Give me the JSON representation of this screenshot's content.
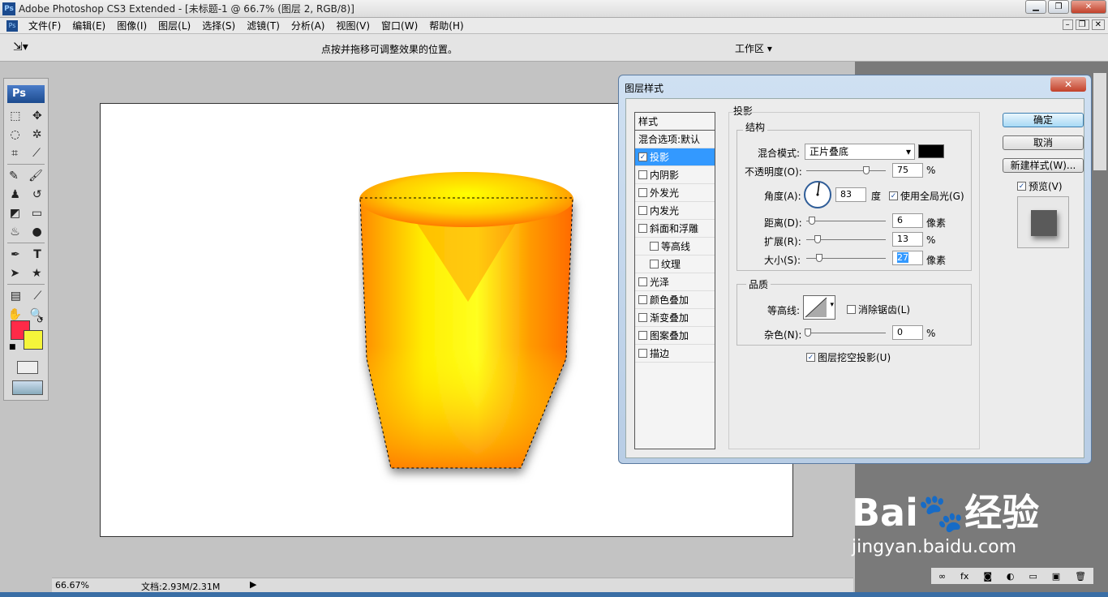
{
  "app": {
    "title": "Adobe Photoshop CS3 Extended - [未标题-1 @ 66.7% (图层 2, RGB/8)]",
    "ps_logo": "Ps"
  },
  "menu": [
    "文件(F)",
    "编辑(E)",
    "图像(I)",
    "图层(L)",
    "选择(S)",
    "滤镜(T)",
    "分析(A)",
    "视图(V)",
    "窗口(W)",
    "帮助(H)"
  ],
  "options_bar": {
    "hint": "点按并拖移可调整效果的位置。",
    "workspace": "工作区"
  },
  "status_bar": {
    "zoom": "66.67%",
    "doc_info": "文档:2.93M/2.31M"
  },
  "colors": {
    "foreground": "#ff2a48",
    "background": "#f5f53a"
  },
  "dialog": {
    "title": "图层样式",
    "styles_header": "样式",
    "blend_defaults": "混合选项:默认",
    "styles": [
      {
        "label": "投影",
        "checked": true,
        "selected": true
      },
      {
        "label": "内阴影",
        "checked": false
      },
      {
        "label": "外发光",
        "checked": false
      },
      {
        "label": "内发光",
        "checked": false
      },
      {
        "label": "斜面和浮雕",
        "checked": false
      },
      {
        "label": "等高线",
        "checked": false,
        "sub": true
      },
      {
        "label": "纹理",
        "checked": false,
        "sub": true
      },
      {
        "label": "光泽",
        "checked": false
      },
      {
        "label": "颜色叠加",
        "checked": false
      },
      {
        "label": "渐变叠加",
        "checked": false
      },
      {
        "label": "图案叠加",
        "checked": false
      },
      {
        "label": "描边",
        "checked": false
      }
    ],
    "section_title": "投影",
    "structure": {
      "title": "结构",
      "blend_mode_label": "混合模式:",
      "blend_mode_value": "正片叠底",
      "shadow_color": "#000000",
      "opacity_label": "不透明度(O):",
      "opacity_value": "75",
      "opacity_unit": "%",
      "angle_label": "角度(A):",
      "angle_value": "83",
      "angle_unit": "度",
      "global_light_label": "使用全局光(G)",
      "distance_label": "距离(D):",
      "distance_value": "6",
      "distance_unit": "像素",
      "spread_label": "扩展(R):",
      "spread_value": "13",
      "spread_unit": "%",
      "size_label": "大小(S):",
      "size_value": "27",
      "size_unit": "像素"
    },
    "quality": {
      "title": "品质",
      "contour_label": "等高线:",
      "anti_alias_label": "消除锯齿(L)",
      "noise_label": "杂色(N):",
      "noise_value": "0",
      "noise_unit": "%"
    },
    "knockout_label": "图层挖空投影(U)",
    "buttons": {
      "ok": "确定",
      "cancel": "取消",
      "new_style": "新建样式(W)...",
      "preview": "预览(V)"
    }
  },
  "watermark": {
    "brand": "Bai",
    "brand_cn": "经验",
    "url": "jingyan.baidu.com"
  }
}
